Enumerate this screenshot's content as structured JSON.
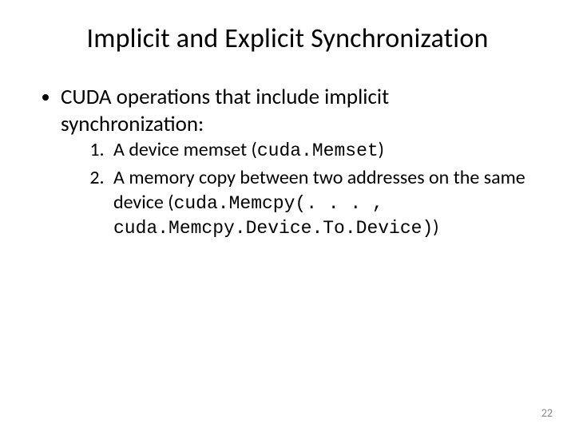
{
  "title": "Implicit and Explicit Synchronization",
  "bullet": "CUDA operations that include implicit synchronization:",
  "items": [
    {
      "text_a": "A device memset (",
      "code_a": "cuda.Memset",
      "text_b": ")"
    },
    {
      "text_a": "A memory copy between two addresses on the same device (",
      "code_a": "cuda.Memcpy(. . . , cuda.Memcpy.Device.To.Device)",
      "text_b": ")"
    }
  ],
  "page_number": "22"
}
